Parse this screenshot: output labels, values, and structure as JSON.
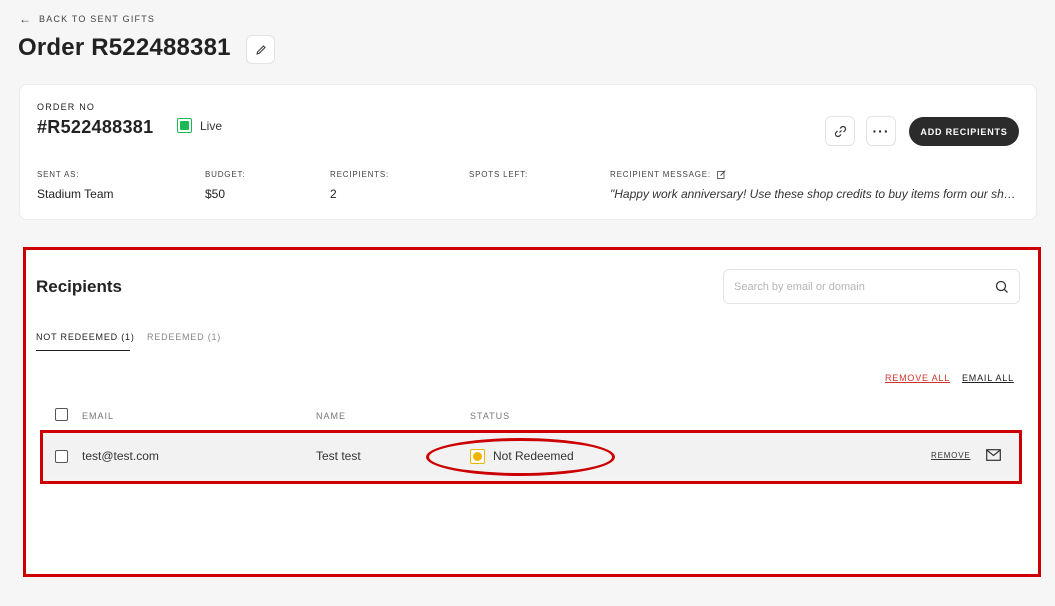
{
  "header": {
    "back_label": "BACK TO SENT GIFTS",
    "title": "Order R522488381"
  },
  "order": {
    "no_label": "ORDER NO",
    "no_value": "#R522488381",
    "status": "Live",
    "status_color": "#1db954",
    "add_recipients_label": "ADD RECIPIENTS",
    "meta": {
      "sent_as_label": "SENT AS:",
      "sent_as_value": "Stadium Team",
      "budget_label": "BUDGET:",
      "budget_value": "$50",
      "recipients_label": "RECIPIENTS:",
      "recipients_value": "2",
      "spots_left_label": "SPOTS LEFT:",
      "message_label": "RECIPIENT MESSAGE:",
      "message_value": "\"Happy work anniversary! Use these shop credits to buy items form our shop.\""
    }
  },
  "recipients": {
    "title": "Recipients",
    "search_placeholder": "Search by email or domain",
    "tabs": [
      {
        "label": "NOT REDEEMED (1)",
        "active": true
      },
      {
        "label": "REDEEMED (1)",
        "active": false
      }
    ],
    "remove_all_label": "REMOVE ALL",
    "email_all_label": "EMAIL ALL",
    "columns": {
      "email": "EMAIL",
      "name": "NAME",
      "status": "STATUS"
    },
    "rows": [
      {
        "email": "test@test.com",
        "name": "Test test",
        "status": "Not Redeemed",
        "status_color": "#f0b400",
        "remove_label": "REMOVE"
      }
    ]
  },
  "highlight_color": "#cc0000"
}
